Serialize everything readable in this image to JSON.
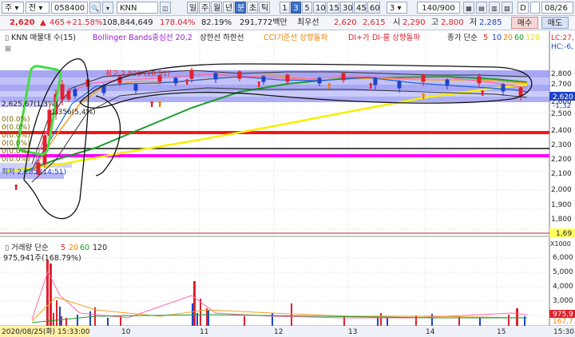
{
  "toolbar": {
    "type_label": "주",
    "type2_label": "전",
    "code_value": "058400",
    "name_value": "KNN",
    "price": "2,620",
    "change": "465",
    "change_pct": "+21.58%",
    "volume": "108,844,649",
    "volume_ratio": "178.04%",
    "turnover_pct": "82.19%",
    "amount": "291,772백만",
    "best_ask_label": "최우선",
    "best_ask": "2,620",
    "best_bid": "2,615",
    "open_label": "시",
    "open": "2,290",
    "high_label": "고",
    "high": "2,800",
    "low_label": "저",
    "low": "2,285",
    "buy_label": "매수",
    "sell_label": "매도",
    "periods": [
      "일",
      "주",
      "월",
      "년",
      "분",
      "초",
      "틱"
    ],
    "minutes": [
      "1",
      "3",
      "5",
      "10",
      "15",
      "30",
      "45",
      "60"
    ],
    "interval_value": "3",
    "count_value": "140/900",
    "date_d": "D",
    "date_value": "08/26"
  },
  "indicators": {
    "knn": "KNN 매물대 수(15)",
    "bollinger": "Bollinger Bands중심선 20,2",
    "upper_lower": "상한선 하한선",
    "cci": "CCI기준선 상향돌파",
    "di": "DI+가 DI-를 상향돌파",
    "ma_label": "종가 단순",
    "ma_periods": [
      "5",
      "10",
      "20",
      "60",
      "120"
    ],
    "lc_label": "LC:27,",
    "hc_label": "HC:-6,"
  },
  "price_chart": {
    "high_annotation": "최고 2,800 (10:51)",
    "low_annotation": "최저 2,285 (14:51)",
    "vp_top_label": "2,625,67(1,3%)",
    "vp_mid_label": "1,356(5,4%)",
    "zero_labels": [
      "0(0.0%)",
      "0(0.0%)",
      "0(0.0%)",
      "0(0.0%)",
      "0(0.0%)",
      "0(0.0%)"
    ],
    "last_price_badge": "2,620",
    "last_change_badge": "-1,32",
    "y_ticks": [
      "2,800",
      "2,700",
      "2,600",
      "2,500",
      "2,400",
      "2,300",
      "2,200",
      "2,100",
      "2,000",
      "1,900",
      "1,800"
    ],
    "right_edge_label": "1,69"
  },
  "volume_chart": {
    "legend": "거래량 단순",
    "ma_periods": [
      "5",
      "20",
      "60",
      "120"
    ],
    "value_label": "975,941주(168.79%)",
    "y_ticks": [
      "6,000",
      "5,000",
      "4,000",
      "3,000",
      "2,000",
      "1,000"
    ],
    "last_badge": "975,9",
    "last_badge2": "167,7",
    "unit_label": "X1000",
    "x_ticks": [
      "10",
      "11",
      "12",
      "13",
      "14",
      "15"
    ],
    "time_cursor": "2020/08/25(화) 15:33:00",
    "right_time": "15:30"
  }
}
